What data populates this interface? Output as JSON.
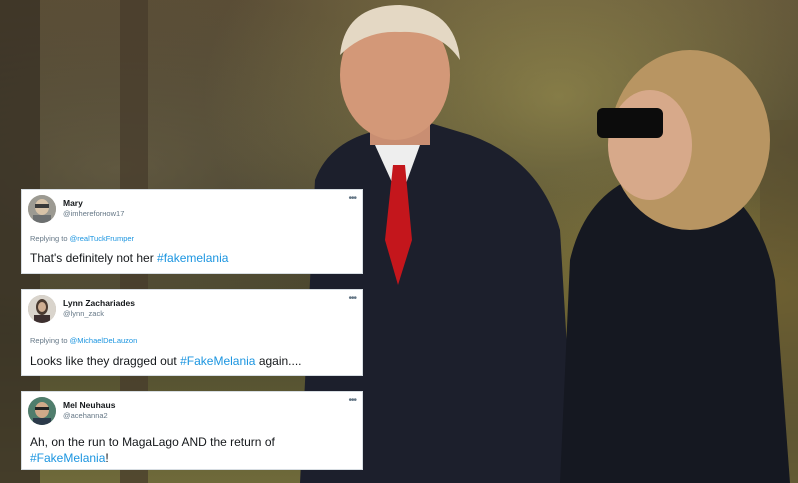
{
  "tweets": [
    {
      "name": "Mary",
      "handle": "@imhereforнow17",
      "reply_prefix": "Replying to",
      "reply_to": "@realTuckFrumper",
      "text": "That's definitely not her ",
      "hashtag": "#fakemelania",
      "text_after": "",
      "more": "•••"
    },
    {
      "name": "Lynn Zachariades",
      "handle": "@lynn_zack",
      "reply_prefix": "Replying to",
      "reply_to": "@MichaelDeLauzon",
      "text": "Looks like they dragged out ",
      "hashtag": "#FakeMelania",
      "text_after": " again....",
      "more": "•••"
    },
    {
      "name": "Mel Neuhaus",
      "handle": "@acehanna2",
      "text": "Ah, on the run to MagaLago AND the return of ",
      "hashtag": "#FakeMelania",
      "text_after": "!",
      "more": "•••"
    }
  ]
}
